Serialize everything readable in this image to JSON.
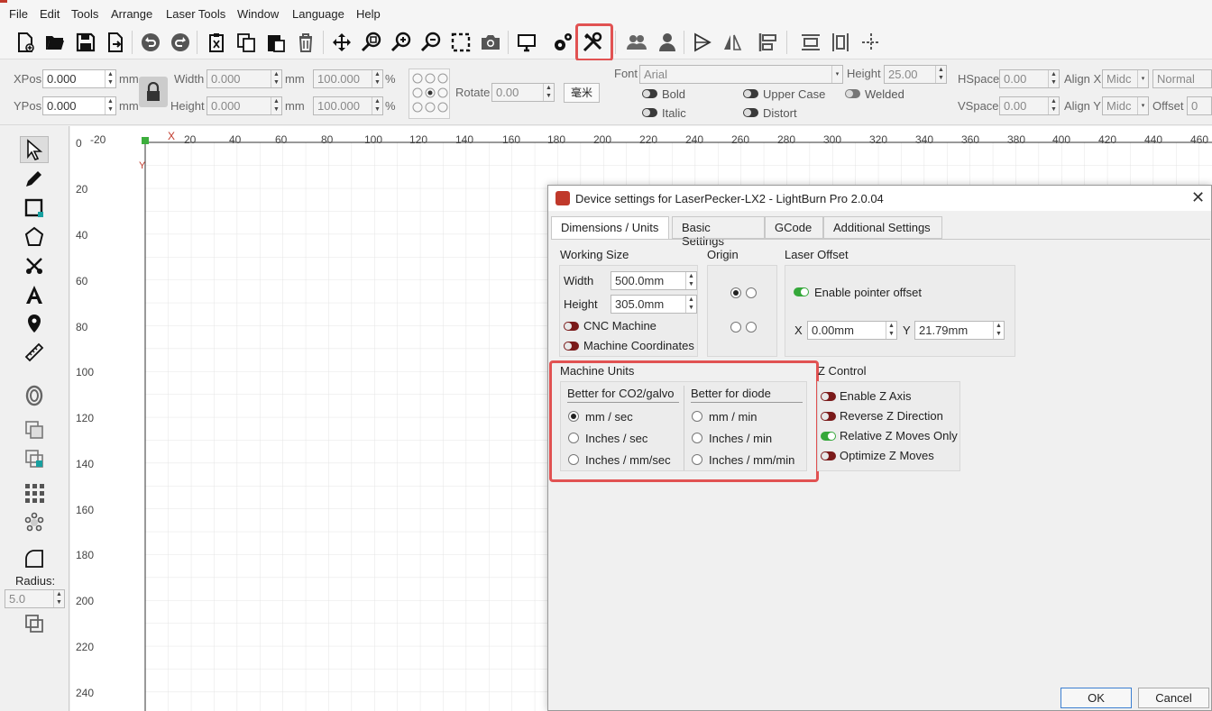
{
  "menu": [
    "File",
    "Edit",
    "Tools",
    "Arrange",
    "Laser Tools",
    "Window",
    "Language",
    "Help"
  ],
  "props": {
    "xpos_label": "XPos",
    "xpos": "0.000",
    "ypos_label": "YPos",
    "ypos": "0.000",
    "unit": "mm",
    "width_label": "Width",
    "width": "0.000",
    "height_label": "Height",
    "height": "0.000",
    "pct_w": "100.000",
    "pct_h": "100.000",
    "pct": "%",
    "rotate_label": "Rotate",
    "rotate": "0.00",
    "unit_btn": "毫米",
    "font_label": "Font",
    "font": "Arial",
    "fheight_label": "Height",
    "fheight": "25.00",
    "bold": "Bold",
    "italic": "Italic",
    "upper": "Upper Case",
    "distort": "Distort",
    "welded": "Welded",
    "hspace_label": "HSpace",
    "hspace": "0.00",
    "vspace_label": "VSpace",
    "vspace": "0.00",
    "alignx_label": "Align X",
    "alignx": "Midc",
    "aligny_label": "Align Y",
    "aligny": "Midc",
    "normal": "Normal",
    "offset_label": "Offset",
    "offset": "0"
  },
  "lefttools": {
    "radius_label": "Radius:",
    "radius": "5.0"
  },
  "ruler": {
    "x": [
      "-20",
      "X",
      "20",
      "40",
      "60",
      "80",
      "100",
      "120",
      "140",
      "160",
      "180",
      "200",
      "220",
      "240",
      "260",
      "280",
      "300",
      "320",
      "340",
      "360",
      "380",
      "400",
      "420",
      "440",
      "460"
    ],
    "y": [
      "0",
      "20",
      "40",
      "60",
      "80",
      "100",
      "120",
      "140",
      "160",
      "180",
      "200",
      "220",
      "240"
    ],
    "y_axis": "Y"
  },
  "dialog": {
    "title": "Device settings for LaserPecker-LX2 - LightBurn Pro 2.0.04",
    "tabs": [
      "Dimensions / Units",
      "Basic Settings",
      "GCode",
      "Additional Settings"
    ],
    "working_size": "Working Size",
    "width_label": "Width",
    "width": "500.0mm",
    "height_label": "Height",
    "height": "305.0mm",
    "cnc": "CNC Machine",
    "machine_coords": "Machine Coordinates",
    "origin": "Origin",
    "laser_offset": "Laser Offset",
    "enable_pointer": "Enable pointer offset",
    "x_label": "X",
    "x": "0.00mm",
    "y_label": "Y",
    "y": "21.79mm",
    "machine_units": "Machine Units",
    "co2_header": "Better for CO2/galvo",
    "diode_header": "Better for diode",
    "co2_opts": [
      "mm / sec",
      "Inches / sec",
      "Inches / mm/sec"
    ],
    "diode_opts": [
      "mm / min",
      "Inches / min",
      "Inches / mm/min"
    ],
    "z_control": "Z Control",
    "z_opts": [
      "Enable Z Axis",
      "Reverse Z Direction",
      "Relative Z Moves Only",
      "Optimize Z Moves"
    ],
    "ok": "OK",
    "cancel": "Cancel"
  },
  "colors": {
    "highlight": "#e15252",
    "toggle_on": "#35a83a",
    "toggle_off": "#7a1a1a"
  }
}
